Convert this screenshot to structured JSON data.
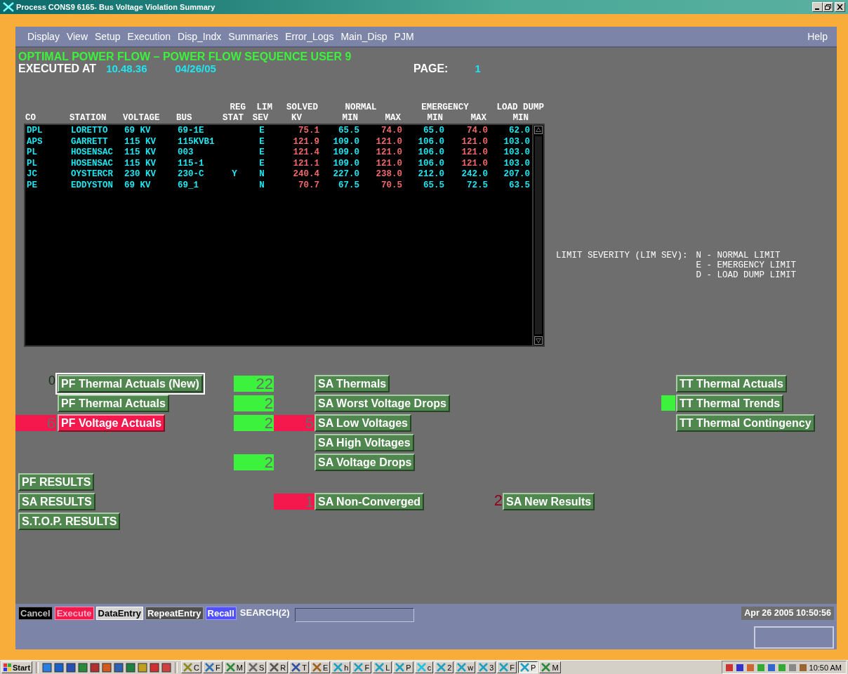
{
  "window": {
    "title": "Process CONS9 6165- Bus Voltage Violation Summary"
  },
  "menu": {
    "items": [
      "Display",
      "View",
      "Setup",
      "Execution",
      "Disp_Indx",
      "Summaries",
      "Error_Logs",
      "Main_Disp",
      "PJM"
    ],
    "help": "Help"
  },
  "header": {
    "title": "OPTIMAL POWER FLOW – POWER FLOW SEQUENCE USER  9",
    "executed_label": "EXECUTED AT",
    "time": "10.48.36",
    "date": "04/26/05",
    "page_label": "PAGE:",
    "page": "1"
  },
  "table": {
    "header_groups": [
      "REG",
      "LIM",
      "SOLVED",
      "NORMAL",
      "EMERGENCY",
      "LOAD DUMP"
    ],
    "columns": [
      "CO",
      "STATION",
      "VOLTAGE",
      "BUS",
      "STAT",
      "SEV",
      "KV",
      "MIN",
      "MAX",
      "MIN",
      "MAX",
      "MIN"
    ],
    "rows": [
      {
        "co": "DPL",
        "station": "LORETTO",
        "voltage": "69 KV",
        "bus": "69-1E",
        "lim_sev": "E",
        "solved_kv": "75.1",
        "normal_min": "65.5",
        "normal_max": "74.0",
        "normal_max_exceeded": true,
        "emergency_min": "65.0",
        "emergency_max": "74.0",
        "emergency_max_exceeded": true,
        "load_dump_min": "62.0"
      },
      {
        "co": "APS",
        "station": "GARRETT",
        "voltage": "115 KV",
        "bus": "115KVB1",
        "lim_sev": "E",
        "solved_kv": "121.9",
        "normal_min": "109.0",
        "normal_max": "121.0",
        "normal_max_exceeded": true,
        "emergency_min": "106.0",
        "emergency_max": "121.0",
        "emergency_max_exceeded": true,
        "load_dump_min": "103.0"
      },
      {
        "co": "PL",
        "station": "HOSENSAC",
        "voltage": "115 KV",
        "bus": "003",
        "lim_sev": "E",
        "solved_kv": "121.4",
        "normal_min": "109.0",
        "normal_max": "121.0",
        "normal_max_exceeded": true,
        "emergency_min": "106.0",
        "emergency_max": "121.0",
        "emergency_max_exceeded": true,
        "load_dump_min": "103.0"
      },
      {
        "co": "PL",
        "station": "HOSENSAC",
        "voltage": "115 KV",
        "bus": "115-1",
        "lim_sev": "E",
        "solved_kv": "121.1",
        "normal_min": "109.0",
        "normal_max": "121.0",
        "normal_max_exceeded": true,
        "emergency_min": "106.0",
        "emergency_max": "121.0",
        "emergency_max_exceeded": true,
        "load_dump_min": "103.0"
      },
      {
        "co": "JC",
        "station": "OYSTERCR",
        "voltage": "230 KV",
        "bus": "230-C",
        "reg_stat": "Y",
        "lim_sev": "N",
        "solved_kv": "240.4",
        "normal_min": "227.0",
        "normal_max": "238.0",
        "normal_max_exceeded": true,
        "emergency_min": "212.0",
        "emergency_max": "242.0",
        "emergency_max_exceeded": false,
        "load_dump_min": "207.0"
      },
      {
        "co": "PE",
        "station": "EDDYSTON",
        "voltage": "69 KV",
        "bus": "69_1",
        "lim_sev": "N",
        "solved_kv": "70.7",
        "normal_min": "67.5",
        "normal_max": "70.5",
        "normal_max_exceeded": true,
        "emergency_min": "65.5",
        "emergency_max": "72.5",
        "emergency_max_exceeded": false,
        "load_dump_min": "63.5"
      }
    ]
  },
  "legend": {
    "title": "LIMIT SEVERITY (LIM SEV):",
    "entries": [
      "N - NORMAL LIMIT",
      "E - EMERGENCY LIMIT",
      "D - LOAD DUMP LIMIT"
    ]
  },
  "pf_buttons": [
    {
      "label": "PF Thermal Actuals (New)",
      "focused": true,
      "alert": false,
      "count": {
        "value": "0",
        "kind": "idle"
      }
    },
    {
      "label": "PF Thermal Actuals",
      "focused": false,
      "alert": false
    },
    {
      "label": "PF Voltage Actuals",
      "focused": false,
      "alert": true,
      "count": {
        "value": "6",
        "kind": "alert"
      }
    }
  ],
  "sa_buttons": [
    {
      "label": "SA Thermals",
      "counts": [
        {
          "value": "22",
          "kind": "ok"
        }
      ]
    },
    {
      "label": "SA Worst Voltage Drops",
      "counts": [
        {
          "value": "2",
          "kind": "ok"
        }
      ]
    },
    {
      "label": "SA Low Voltages",
      "counts": [
        {
          "value": "2",
          "kind": "ok"
        },
        {
          "value": "5",
          "kind": "alert"
        }
      ]
    },
    {
      "label": "SA High Voltages"
    },
    {
      "label": "SA Voltage Drops",
      "counts": [
        {
          "value": "2",
          "kind": "ok"
        }
      ]
    }
  ],
  "results_buttons": [
    "PF RESULTS",
    "SA RESULTS",
    "S.T.O.P. RESULTS"
  ],
  "sa_non_converged": {
    "label": "SA Non-Converged",
    "counts": [
      {
        "value": "1",
        "kind": "alert"
      }
    ]
  },
  "sa_new_results": {
    "label": "SA New Results",
    "count": {
      "value": "2",
      "kind": "new"
    }
  },
  "tt_buttons": [
    {
      "label": "TT Thermal Actuals",
      "flagged": false
    },
    {
      "label": "TT Thermal Trends",
      "flagged": true
    },
    {
      "label": "TT Thermal Contingency",
      "flagged": false
    }
  ],
  "command_bar": {
    "buttons": [
      {
        "label": "Cancel",
        "kind": "cancel"
      },
      {
        "label": "Execute",
        "kind": "execute"
      },
      {
        "label": "DataEntry",
        "kind": "light"
      },
      {
        "label": "RepeatEntry",
        "kind": "dark"
      },
      {
        "label": "Recall",
        "kind": "recall"
      }
    ],
    "search_label": "SEARCH(2)",
    "timestamp": "Apr 26 2005 10:50:56"
  },
  "taskbar": {
    "start": "Start",
    "tasks": [
      {
        "label": "C",
        "selected": false
      },
      {
        "label": "F",
        "selected": false
      },
      {
        "label": "M",
        "selected": false
      },
      {
        "label": "S",
        "selected": false
      },
      {
        "label": "R",
        "selected": false
      },
      {
        "label": "T",
        "selected": false
      },
      {
        "label": "E",
        "selected": false
      },
      {
        "label": "h",
        "selected": false
      },
      {
        "label": "F",
        "selected": false
      },
      {
        "label": "L",
        "selected": false
      },
      {
        "label": "P",
        "selected": false
      },
      {
        "label": "c",
        "selected": false
      },
      {
        "label": "2",
        "selected": false
      },
      {
        "label": "w",
        "selected": false
      },
      {
        "label": "3",
        "selected": false
      },
      {
        "label": "F",
        "selected": false
      },
      {
        "label": "P",
        "selected": true
      },
      {
        "label": "M",
        "selected": false
      }
    ],
    "clock": "10:50 AM"
  }
}
